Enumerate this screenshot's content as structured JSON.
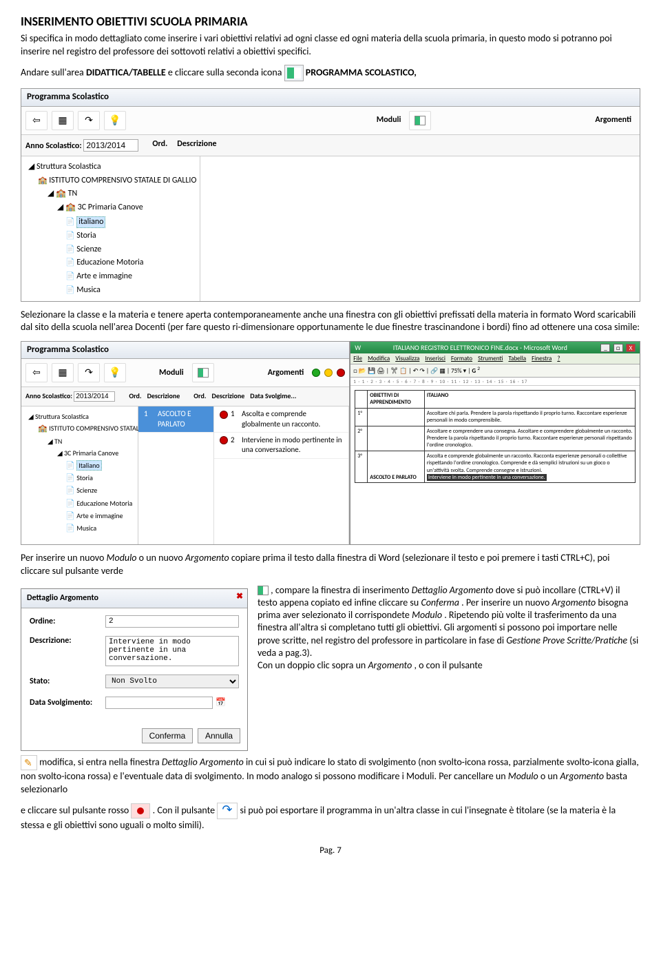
{
  "doc": {
    "title": "INSERIMENTO OBIETTIVI SCUOLA PRIMARIA",
    "p1": "Si specifica in modo dettagliato come inserire i vari obiettivi relativi ad ogni classe ed ogni materia della scuola primaria, in questo modo si potranno poi inserire nel registro del professore dei sottovoti relativi a obiettivi specifici.",
    "p2a": "Andare sull'area ",
    "p2b": "DIDATTICA/TABELLE",
    "p2c": " e cliccare sulla seconda icona ",
    "p2d": "PROGRAMMA SCOLASTICO,",
    "p3": "Selezionare la classe e la materia e tenere aperta contemporaneamente anche una finestra con gli obiettivi prefissati della materia in formato Word scaricabili dal sito della scuola nell'area Docenti (per fare questo ri-dimensionare opportunamente le due finestre trascinandone i bordi) fino ad ottenere una cosa simile:",
    "p4a": "Per inserire un nuovo ",
    "p4b": "Modulo",
    "p4c": " o un nuovo ",
    "p4d": "Argomento",
    "p4e": " copiare prima il testo dalla finestra di Word (selezionare il testo e poi premere i tasti CTRL+C), poi cliccare sul pulsante verde ",
    "p4f": ", compare la finestra di inserimento ",
    "p4g": "Dettaglio Argomento",
    "p4h": " dove si può incollare (CTRL+V) il testo appena copiato ed infine cliccare su ",
    "p4i": "Conferma",
    "p4j": ". Per inserire un nuovo ",
    "p4k": "Argomento",
    "p4l": " bisogna prima aver selezionato il corrispondete ",
    "p4m": "Modulo",
    "p4n": ". Ripetendo più volte il trasferimento da una finestra all'altra si completano tutti gli obiettivi. Gli argomenti si possono poi importare nelle prove scritte, nel registro del professore in particolare in fase di ",
    "p4o": "Gestione Prove Scritte/Pratiche",
    "p4p": " (si veda a pag.3).",
    "p4q": "Con un doppio clic sopra un ",
    "p4r": "Argomento",
    "p4s": ", o con il pulsante",
    "p5a": "modifica, si entra nella finestra ",
    "p5b": "Dettaglio Argomento",
    "p5c": " in cui si può indicare lo stato di svolgimento (non svolto-icona rossa, parzialmente svolto-icona gialla, non svolto-icona rossa) e l'eventuale data di svolgimento. In modo analogo si possono modificare i Moduli. Per cancellare un ",
    "p5d": "Modulo",
    "p5e": " o un ",
    "p5f": "Argomento",
    "p5g": " basta selezionarlo",
    "p6a": "e cliccare sul pulsante rosso ",
    "p6b": ". Con il pulsante ",
    "p6c": " si può poi esportare il programma in un'altra classe in cui l'insegnate è titolare (se la materia è la stessa e gli obiettivi sono uguali o molto simili).",
    "page": "Pag. 7"
  },
  "win1": {
    "title": "Programma Scolastico",
    "moduliLabel": "Moduli",
    "argomentiLabel": "Argomenti",
    "annoLabel": "Anno Scolastico:",
    "annoVal": "2013/2014",
    "ordLabel": "Ord.",
    "descLabel": "Descrizione",
    "tree": {
      "root": "Struttura Scolastica",
      "l2": "ISTITUTO COMPRENSIVO STATALE DI GALLIO",
      "l3": "TN",
      "l4": "3C Primaria Canove",
      "items": [
        "italiano",
        "Storia",
        "Scienze",
        "Educazione Motoria",
        "Arte e immagine",
        "Musica"
      ]
    }
  },
  "win2": {
    "title": "Programma Scolastico",
    "moduliLabel": "Moduli",
    "argomentiLabel": "Argomenti",
    "annoLabel": "Anno Scolastico:",
    "annoVal": "2013/2014",
    "ordLabel": "Ord.",
    "descLabel": "Descrizione",
    "dataLabel": "Data Svolgime...",
    "tree": {
      "root": "Struttura Scolastica",
      "l2": "ISTITUTO COMPRENSIVO STATALE DI GALLIO",
      "l3": "TN",
      "l4": "3C Primaria Canove",
      "items": [
        "Italiano",
        "Storia",
        "Scienze",
        "Educazione Motoria",
        "Arte e immagine",
        "Musica"
      ]
    },
    "moduloSel": {
      "ord": "1",
      "desc": "ASCOLTO E PARLATO"
    },
    "argomenti": [
      {
        "ord": "1",
        "desc": "Ascolta e comprende globalmente un racconto."
      },
      {
        "ord": "2",
        "desc": "Interviene in modo pertinente in una conversazione."
      }
    ]
  },
  "word": {
    "title": "ITALIANO REGISTRO ELETTRONICO FINE.docx - Microsoft Word",
    "menu": [
      "File",
      "Modifica",
      "Visualizza",
      "Inserisci",
      "Formato",
      "Strumenti",
      "Tabella",
      "Finestra",
      "?"
    ],
    "zoom": "75%",
    "ruler": "1 · 1 · 2 · 3 · 4 · 5 · 6 · 7 · 8 · 9 · 10 · 11 · 12 · 13 · 14 · 15 · 16 · 17",
    "th1": "OBIETTIVI DI APPRENDIMENTO",
    "th2": "ITALIANO",
    "rows": [
      {
        "n": "1°",
        "txt": "Ascoltare chi parla. Prendere la parola rispettando il proprio turno. Raccontare esperienze personali in modo comprensibile."
      },
      {
        "n": "2°",
        "txt": "Ascoltare e comprendere una consegna. Ascoltare e comprendere globalmente un racconto. Prendere la parola rispettando il proprio turno. Raccontare esperienze personali rispettando l'ordine cronologico."
      },
      {
        "n": "3°",
        "hi": "Interviene in modo pertinente in una conversazione.",
        "txt": "Ascolta e comprende globalmente un racconto. Racconta esperienze personali o collettive rispettando l'ordine cronologico. Comprende e dà semplici istruzioni su un gioco o un'attività svolta. Comprende consegne e istruzioni."
      }
    ],
    "section": "ASCOLTO E PARLATO"
  },
  "dialog": {
    "title": "Dettaglio Argomento",
    "ordineLabel": "Ordine:",
    "ordineVal": "2",
    "descLabel": "Descrizione:",
    "descVal": "Interviene in modo pertinente in una conversazione.",
    "statoLabel": "Stato:",
    "statoVal": "Non Svolto",
    "dataLabel": "Data Svolgimento:",
    "confirm": "Conferma",
    "cancel": "Annulla"
  }
}
